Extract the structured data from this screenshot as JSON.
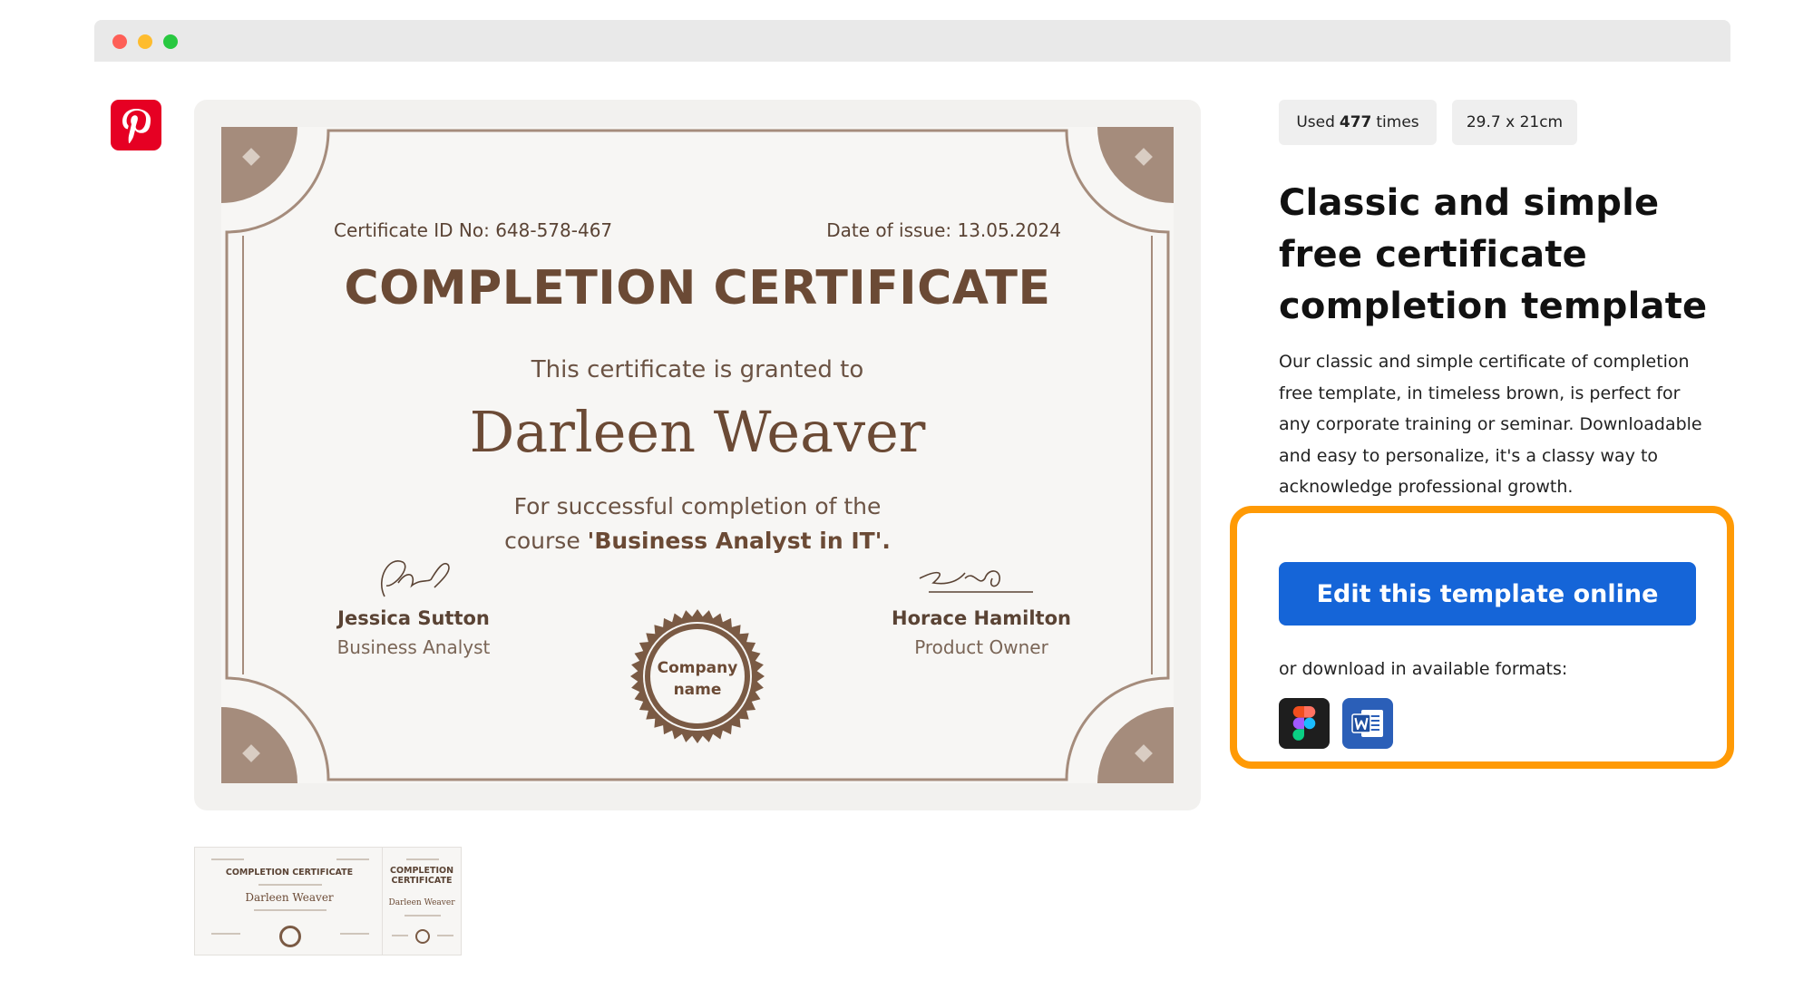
{
  "window": {
    "controls": [
      "close",
      "minimize",
      "maximize"
    ]
  },
  "pinterest": {
    "icon": "pinterest-icon",
    "color": "#e60023"
  },
  "certificate": {
    "id_label": "Certificate ID No: 648-578-467",
    "date_label": "Date of issue: 13.05.2024",
    "title": "COMPLETION CERTIFICATE",
    "granted_text": "This certificate is granted to",
    "recipient": "Darleen Weaver",
    "reason_line1": "For successful completion of the",
    "reason_prefix": "course ",
    "reason_course": "'Business Analyst in IT'.",
    "signer_left": {
      "name": "Jessica Sutton",
      "role": "Business Analyst"
    },
    "signer_right": {
      "name": "Horace Hamilton",
      "role": "Product Owner"
    },
    "seal_line1": "Company",
    "seal_line2": "name",
    "accent_color": "#6b4a35"
  },
  "thumbnails": [
    {
      "title": "COMPLETION CERTIFICATE",
      "name": "Darleen Weaver"
    },
    {
      "title_line1": "COMPLETION",
      "title_line2": "CERTIFICATE",
      "name": "Darleen Weaver"
    }
  ],
  "badges": {
    "used_prefix": "Used",
    "used_count": "477",
    "used_suffix": "times",
    "size": "29.7 x 21cm"
  },
  "template": {
    "title_line1": "Classic and simple",
    "title_line2": "free certificate",
    "title_line3": "completion template",
    "description": "Our classic and simple certificate of completion free template, in timeless brown, is perfect for any corporate training or seminar. Downloadable and easy to personalize, it's a classy way to acknowledge professional growth."
  },
  "actions": {
    "edit_label": "Edit this template online",
    "formats_label": "or download in available formats:",
    "formats": [
      {
        "icon": "figma-icon"
      },
      {
        "icon": "word-icon"
      }
    ],
    "button_color": "#1565d8",
    "highlight_color": "#ff9a05"
  }
}
